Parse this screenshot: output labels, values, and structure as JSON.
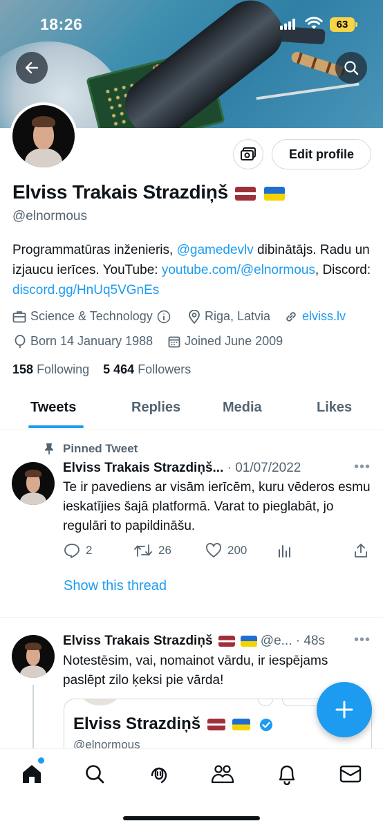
{
  "status_bar": {
    "time": "18:26",
    "battery": "63"
  },
  "profile": {
    "name": "Elviss Trakais Strazdiņš",
    "handle": "@elnormous",
    "edit_label": "Edit profile",
    "bio": {
      "part1": "Programmatūras inženieris, ",
      "mention": "@gamedevlv",
      "part2": " dibinātājs. Radu un izjaucu ierīces. YouTube: ",
      "youtube": "youtube.com/@elnormous",
      "part3": ", Discord: ",
      "discord": "discord.gg/HnUq5VGnEs"
    },
    "category": "Science & Technology",
    "location": "Riga, Latvia",
    "website": "elviss.lv",
    "born": "Born 14 January 1988",
    "joined": "Joined June 2009",
    "following_count": "158",
    "following_label": "Following",
    "followers_count": "5 464",
    "followers_label": "Followers"
  },
  "tabs": [
    "Tweets",
    "Replies",
    "Media",
    "Likes"
  ],
  "pinned": {
    "label": "Pinned Tweet",
    "name": "Elviss Trakais Strazdiņš...",
    "date": "· 01/07/2022",
    "text": "Te ir pavediens ar visām ierīcēm, kuru vēderos esmu ieskatījies šajā platformā. Varat to pieglabāt, jo regulāri to papildināšu.",
    "replies": "2",
    "retweets": "26",
    "likes": "200",
    "show_thread": "Show this thread"
  },
  "tweet2": {
    "name": "Elviss Trakais Strazdiņš",
    "handle_time": "@e... · 48s",
    "text": "Notestēsim, vai, nomainot vārdu, ir iespējams paslēpt zilo ķeksi pie vārda!",
    "embed_name": "Elviss Strazdiņš",
    "embed_handle": "@elnormous"
  },
  "colors": {
    "accent": "#1d9bf0",
    "text": "#0f1419",
    "muted": "#536471"
  }
}
